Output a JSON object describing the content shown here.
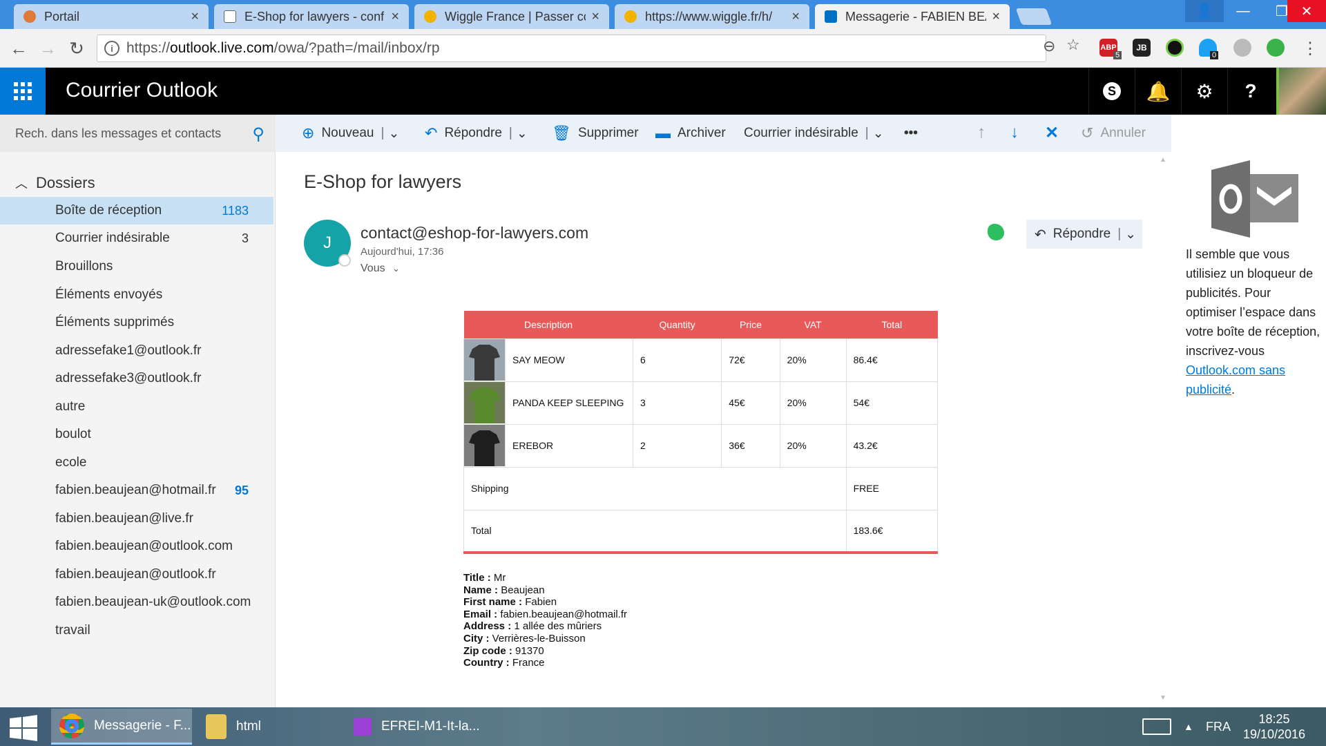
{
  "browser": {
    "tabs": [
      {
        "title": "Portail",
        "active": false
      },
      {
        "title": "E-Shop for lawyers - conf",
        "active": false
      },
      {
        "title": "Wiggle France | Passer co",
        "active": false
      },
      {
        "title": "https://www.wiggle.fr/h/",
        "active": false
      },
      {
        "title": "Messagerie - FABIEN BEA",
        "active": true
      }
    ],
    "url_prefix": "https://",
    "url_host": "outlook.live.com",
    "url_path": "/owa/?path=/mail/inbox/rp",
    "ext_badges": {
      "abp": "5",
      "ghost": "0"
    }
  },
  "app": {
    "title": "Courrier Outlook"
  },
  "search": {
    "placeholder": "Rech. dans les messages et contacts"
  },
  "toolbar": {
    "new_label": "Nouveau",
    "reply_label": "Répondre",
    "delete_label": "Supprimer",
    "archive_label": "Archiver",
    "junk_label": "Courrier indésirable",
    "more_label": "•••",
    "undo_label": "Annuler"
  },
  "sidebar": {
    "heading": "Dossiers",
    "folders": [
      {
        "name": "Boîte de réception",
        "count": "1183",
        "selected": true
      },
      {
        "name": "Courrier indésirable",
        "count": "3"
      },
      {
        "name": "Brouillons",
        "count": ""
      },
      {
        "name": "Éléments envoyés",
        "count": ""
      },
      {
        "name": "Éléments supprimés",
        "count": ""
      },
      {
        "name": "adressefake1@outlook.fr",
        "count": ""
      },
      {
        "name": "adressefake3@outlook.fr",
        "count": ""
      },
      {
        "name": "autre",
        "count": ""
      },
      {
        "name": "boulot",
        "count": ""
      },
      {
        "name": "ecole",
        "count": ""
      },
      {
        "name": "fabien.beaujean@hotmail.fr",
        "count": "95"
      },
      {
        "name": "fabien.beaujean@live.fr",
        "count": ""
      },
      {
        "name": "fabien.beaujean@outlook.com",
        "count": ""
      },
      {
        "name": "fabien.beaujean@outlook.fr",
        "count": ""
      },
      {
        "name": "fabien.beaujean-uk@outlook.com",
        "count": ""
      },
      {
        "name": "travail",
        "count": ""
      }
    ]
  },
  "message": {
    "subject": "E-Shop for lawyers",
    "avatar_letter": "J",
    "sender": "contact@eshop-for-lawyers.com",
    "date": "Aujourd'hui, 17:36",
    "to": "Vous",
    "reply_label": "Répondre",
    "order": {
      "headers": [
        "Description",
        "Quantity",
        "Price",
        "VAT",
        "Total"
      ],
      "items": [
        {
          "name": "SAY MEOW",
          "qty": "6",
          "price": "72€",
          "vat": "20%",
          "total": "86.4€",
          "color": "#3a3a3a"
        },
        {
          "name": "PANDA KEEP SLEEPING",
          "qty": "3",
          "price": "45€",
          "vat": "20%",
          "total": "54€",
          "color": "#5a8a2e"
        },
        {
          "name": "EREBOR",
          "qty": "2",
          "price": "36€",
          "vat": "20%",
          "total": "43.2€",
          "color": "#1e1e1e"
        }
      ],
      "shipping_label": "Shipping",
      "shipping_value": "FREE",
      "total_label": "Total",
      "total_value": "183.6€"
    },
    "customer": {
      "title_label": "Title :",
      "title": "Mr",
      "name_label": "Name :",
      "name": "Beaujean",
      "firstname_label": "First name :",
      "firstname": "Fabien",
      "email_label": "Email :",
      "email": "fabien.beaujean@hotmail.fr",
      "address_label": "Address :",
      "address": "1 allée des mûriers",
      "city_label": "City :",
      "city": "Verrières-le-Buisson",
      "zip_label": "Zip code :",
      "zip": "91370",
      "country_label": "Country :",
      "country": "France"
    }
  },
  "ad": {
    "text": "Il semble que vous utilisiez un bloqueur de publicités. Pour optimiser l’espace dans votre boîte de réception, inscrivez-vous ",
    "link": "Outlook.com sans publicité",
    "suffix": "."
  },
  "taskbar": {
    "tasks": [
      "Messagerie - F...",
      "html",
      "EFREI-M1-It-la..."
    ],
    "lang": "FRA",
    "time": "18:25",
    "date": "19/10/2016"
  },
  "colors": {
    "accent": "#0078d7",
    "table_header": "#e85a5a",
    "avatar": "#16a3a7"
  }
}
